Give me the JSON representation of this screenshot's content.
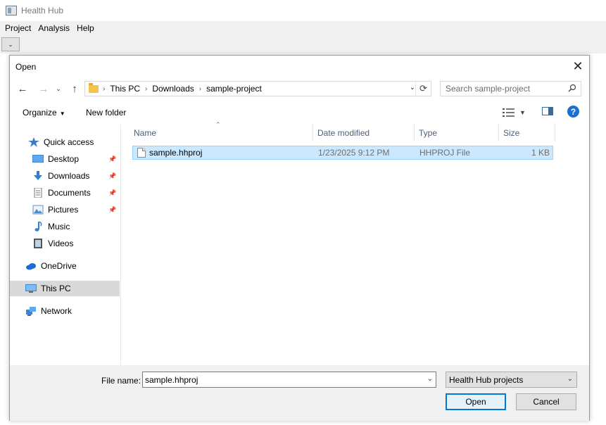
{
  "app": {
    "title": "Health Hub",
    "menu": [
      "Project",
      "Analysis",
      "Help"
    ],
    "toolbar_dropdown": "⌄"
  },
  "dialog": {
    "title": "Open",
    "breadcrumb": [
      "This PC",
      "Downloads",
      "sample-project"
    ],
    "search_placeholder": "Search sample-project",
    "organize_label": "Organize",
    "new_folder_label": "New folder",
    "nav_items": [
      {
        "label": "Quick access",
        "icon": "star-icon",
        "pinned": false
      },
      {
        "label": "Desktop",
        "icon": "desktop-icon",
        "pinned": true
      },
      {
        "label": "Downloads",
        "icon": "download-icon",
        "pinned": true
      },
      {
        "label": "Documents",
        "icon": "document-icon",
        "pinned": true
      },
      {
        "label": "Pictures",
        "icon": "picture-icon",
        "pinned": true
      },
      {
        "label": "Music",
        "icon": "music-icon",
        "pinned": false
      },
      {
        "label": "Videos",
        "icon": "video-icon",
        "pinned": false
      },
      {
        "label": "OneDrive",
        "icon": "cloud-icon",
        "pinned": false
      },
      {
        "label": "This PC",
        "icon": "computer-icon",
        "pinned": false,
        "selected": true
      },
      {
        "label": "Network",
        "icon": "network-icon",
        "pinned": false
      }
    ],
    "columns": [
      "Name",
      "Date modified",
      "Type",
      "Size"
    ],
    "files": [
      {
        "name": "sample.hhproj",
        "date_modified": "1/23/2025 9:12 PM",
        "type": "HHPROJ File",
        "size": "1 KB",
        "selected": true
      }
    ],
    "file_name_label": "File name:",
    "file_name_value": "sample.hhproj",
    "file_type_value": "Health Hub projects",
    "open_label": "Open",
    "cancel_label": "Cancel"
  },
  "colors": {
    "accent": "#0078d7",
    "selection": "#cce8ff",
    "folder": "#f4c54a"
  }
}
